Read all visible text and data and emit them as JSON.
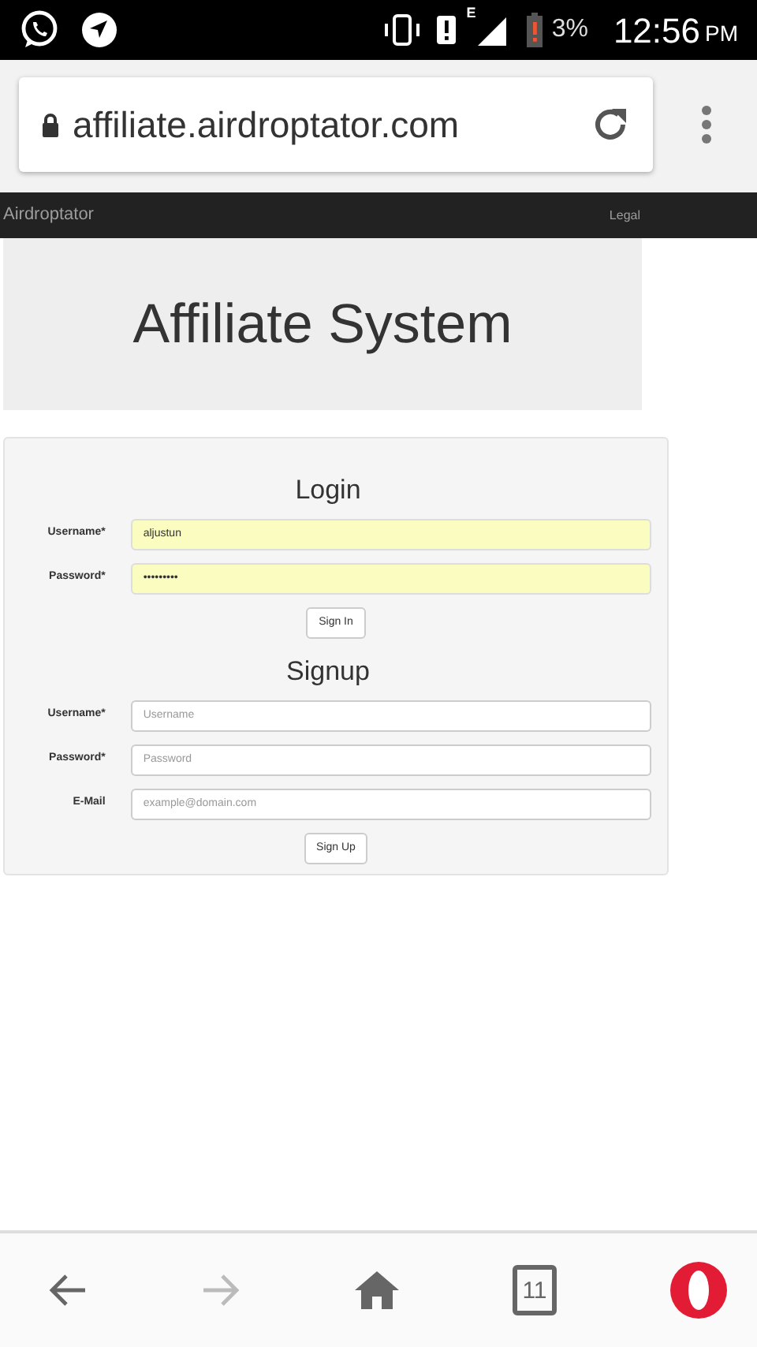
{
  "status_bar": {
    "battery": "3%",
    "time": "12:56",
    "meridiem": "PM",
    "network": "E"
  },
  "browser": {
    "url": "affiliate.airdroptator.com"
  },
  "navbar": {
    "brand": "Airdroptator",
    "links": [
      "Legal"
    ]
  },
  "jumbotron": {
    "title": "Affiliate System"
  },
  "forms": [
    {
      "title": "Login",
      "fields": [
        {
          "label": "Username*",
          "value": "aljustun",
          "autofilled": true
        },
        {
          "label": "Password*",
          "value": "•••••••••",
          "autofilled": true
        }
      ],
      "button": "Sign In"
    },
    {
      "title": "Signup",
      "fields": [
        {
          "label": "Username*",
          "placeholder": "Username",
          "autofilled": false
        },
        {
          "label": "Password*",
          "placeholder": "Password",
          "autofilled": false
        },
        {
          "label": "E-Mail",
          "placeholder": "example@domain.com",
          "autofilled": false
        }
      ],
      "button": "Sign Up"
    }
  ],
  "bottom_bar": [
    {
      "kind": "back",
      "disabled": false
    },
    {
      "kind": "forward",
      "disabled": true
    },
    {
      "kind": "home",
      "disabled": false
    },
    {
      "kind": "tabs",
      "count": "11",
      "disabled": false
    },
    {
      "kind": "menu",
      "disabled": false
    }
  ]
}
